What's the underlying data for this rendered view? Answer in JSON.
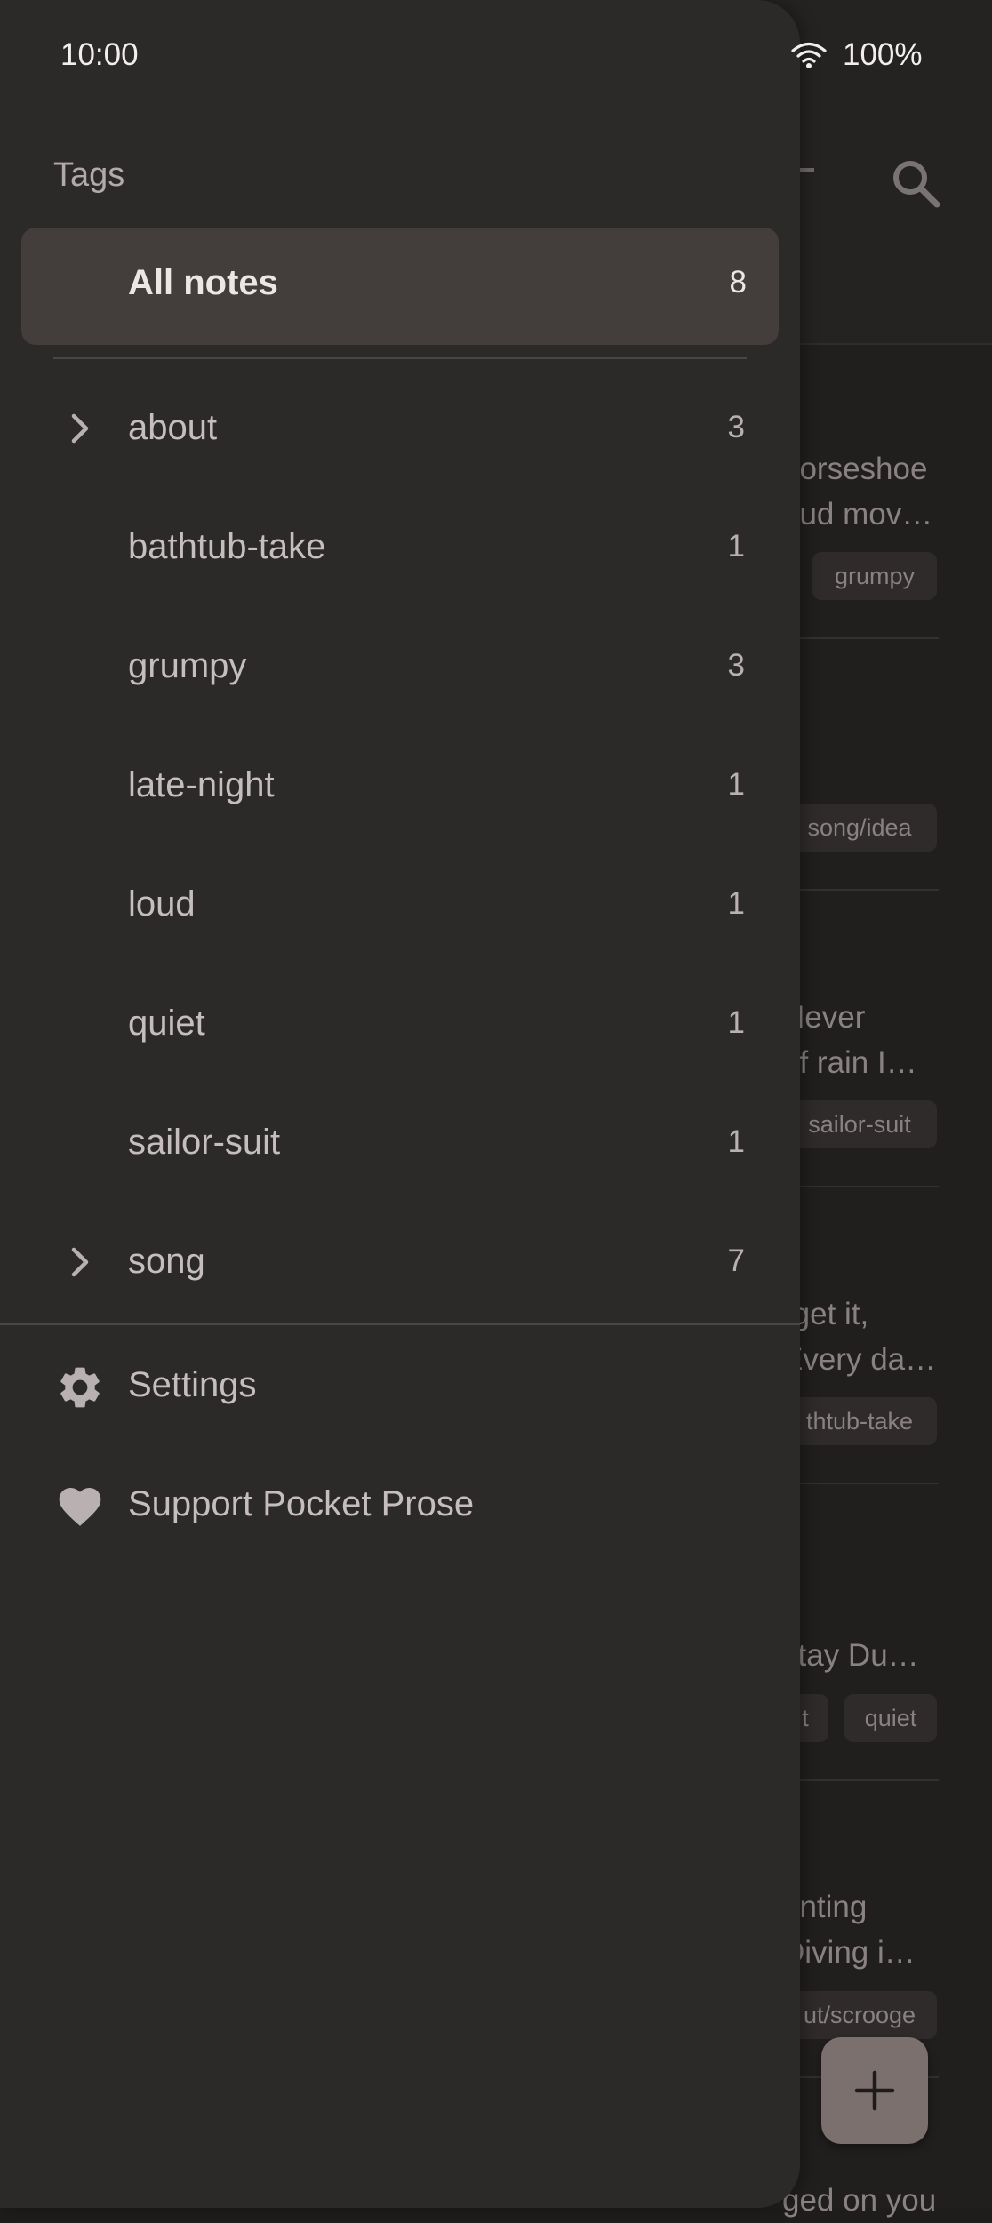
{
  "status": {
    "time": "10:00",
    "battery": "100%"
  },
  "drawer": {
    "heading": "Tags",
    "all_notes": {
      "label": "All notes",
      "count": "8"
    },
    "tags": [
      {
        "label": "about",
        "count": "3",
        "expandable": true
      },
      {
        "label": "bathtub-take",
        "count": "1",
        "expandable": false
      },
      {
        "label": "grumpy",
        "count": "3",
        "expandable": false
      },
      {
        "label": "late-night",
        "count": "1",
        "expandable": false
      },
      {
        "label": "loud",
        "count": "1",
        "expandable": false
      },
      {
        "label": "quiet",
        "count": "1",
        "expandable": false
      },
      {
        "label": "sailor-suit",
        "count": "1",
        "expandable": false
      },
      {
        "label": "song",
        "count": "7",
        "expandable": true
      }
    ],
    "menu": [
      {
        "label": "Settings",
        "icon": "gear-icon"
      },
      {
        "label": "Support Pocket Prose",
        "icon": "heart-icon"
      }
    ]
  },
  "background_notes": [
    {
      "lines": [
        "horseshoe",
        "oud mov…"
      ],
      "chips": [
        "grumpy"
      ]
    },
    {
      "lines": [],
      "chips": [
        "song/idea"
      ]
    },
    {
      "lines": [
        "Never",
        "of rain I…"
      ],
      "chips": [
        "sailor-suit"
      ]
    },
    {
      "lines": [
        "rget it,",
        "Every da…"
      ],
      "chips": [
        "thtub-take"
      ]
    },
    {
      "lines": [
        "stay Du…"
      ],
      "chips": [
        "t",
        "quiet"
      ]
    },
    {
      "lines": [
        "unting",
        "Diving i…"
      ],
      "chips": [
        "ut/scrooge"
      ]
    },
    {
      "lines": [
        "ged on you"
      ],
      "chips": []
    }
  ],
  "colors": {
    "drawer_bg": "#2c2929",
    "selected_bg": "#433e3c",
    "fab_bg": "#7b706e"
  }
}
